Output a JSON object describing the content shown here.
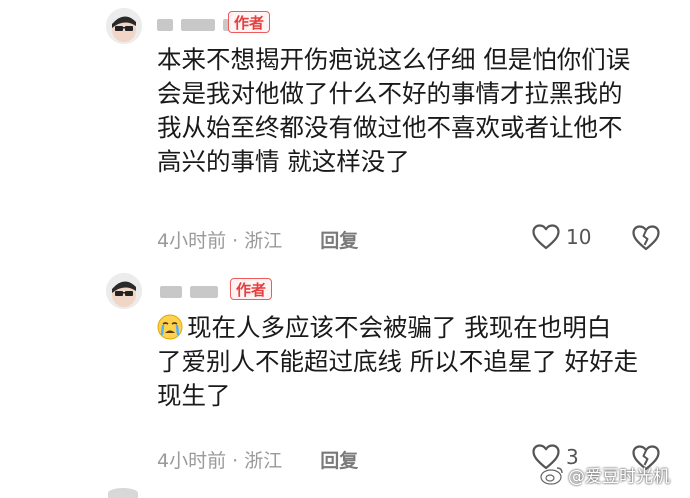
{
  "comments": [
    {
      "author_badge": "作者",
      "lines": [
        "本来不想揭开伤疤说这么仔细 但是怕你们误",
        "会是我对他做了什么不好的事情才拉黑我的",
        "我从始至终都没有做过他不喜欢或者让他不",
        "高兴的事情 就这样没了"
      ],
      "time_location": "4小时前 · 浙江",
      "reply_label": "回复",
      "like_count": "10"
    },
    {
      "author_badge": "作者",
      "emoji": "crying-face-icon",
      "lines": [
        "现在人多应该不会被骗了 我现在也明白",
        "了爱别人不能超过底线 所以不追星了 好好走",
        "现生了"
      ],
      "time_location": "4小时前 · 浙江",
      "reply_label": "回复",
      "like_count": "3"
    }
  ],
  "watermark": {
    "icon": "weibo-icon",
    "text": "@爱豆时光机"
  },
  "colors": {
    "badge": "#e53f3f",
    "text": "#1a1a1a",
    "meta": "#9a9a9a"
  }
}
